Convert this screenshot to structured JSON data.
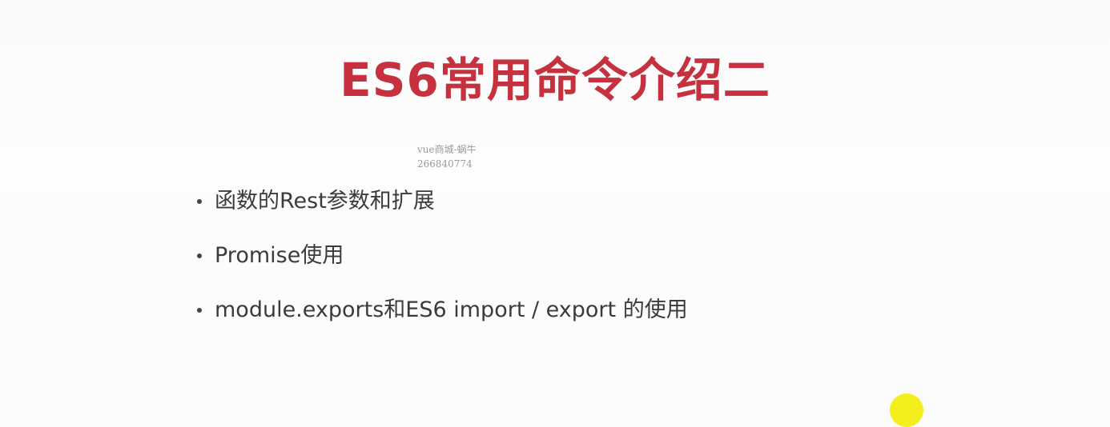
{
  "slide": {
    "title": "ES6常用命令介绍二",
    "watermark": {
      "line1": "vue商城-蜗牛",
      "line2": "266840774"
    },
    "bullets": [
      {
        "text": "函数的Rest参数和扩展"
      },
      {
        "text": "Promise使用"
      },
      {
        "text": "module.exports和ES6 import / export 的使用"
      }
    ]
  },
  "colors": {
    "title": "#c6313f",
    "text": "#3b3b3b",
    "pointer": "#f4ee1c"
  }
}
